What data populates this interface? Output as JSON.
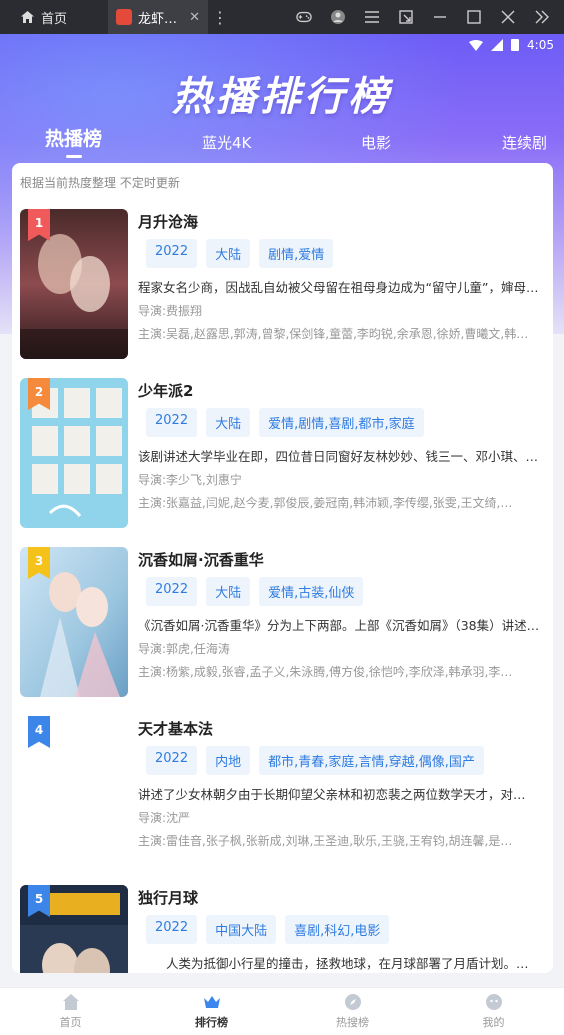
{
  "emulator": {
    "home_label": "首页",
    "tab_label": "龙虾…",
    "tab_close": "✕",
    "more": "⋮",
    "tool_icons": [
      "gamepad-icon",
      "user-circle-icon",
      "menu-icon",
      "popout-icon",
      "minimize-icon",
      "maximize-icon",
      "close-icon",
      "collapse-icon"
    ]
  },
  "status_bar": {
    "time": "4:05"
  },
  "hero": {
    "title": "热播排行榜"
  },
  "tabs": [
    {
      "label": "热播榜",
      "active": true
    },
    {
      "label": "蓝光4K",
      "active": false
    },
    {
      "label": "电影",
      "active": false
    },
    {
      "label": "连续剧",
      "active": false
    }
  ],
  "list": {
    "subtitle": "根据当前热度整理 不定时更新",
    "items": [
      {
        "rank": "1",
        "rank_color": "#f05a5a",
        "title": "月升沧海",
        "tags": [
          "2022",
          "大陆",
          "剧情,爱情"
        ],
        "desc": "程家女名少商，因战乱自幼被父母留在祖母身边成为“留守儿童”，婶母苛刻…",
        "director": "导演:费振翔",
        "cast": "主演:吴磊,赵露思,郭涛,曾黎,保剑锋,童蕾,李昀锐,余承恩,徐娇,曹曦文,韩…"
      },
      {
        "rank": "2",
        "rank_color": "#f58a3c",
        "title": "少年派2",
        "tags": [
          "2022",
          "大陆",
          "爱情,剧情,喜剧,都市,家庭"
        ],
        "desc": "该剧讲述大学毕业在即，四位昔日同窗好友林妙妙、钱三一、邓小琪、江天昊…",
        "director": "导演:李少飞,刘惠宁",
        "cast": "主演:张嘉益,闫妮,赵今麦,郭俊辰,姜冠南,韩沛颖,李传缨,张雯,王文绮,…"
      },
      {
        "rank": "3",
        "rank_color": "#f5c21b",
        "title": "沉香如屑·沉香重华",
        "tags": [
          "2022",
          "大陆",
          "爱情,古装,仙侠"
        ],
        "desc": "《沉香如屑·沉香重华》分为上下两部。上部《沉香如屑》（38集）讲述…",
        "director": "导演:郭虎,任海涛",
        "cast": "主演:杨紫,成毅,张睿,孟子义,朱泳腾,傅方俊,徐恺吟,李欣泽,韩承羽,李…"
      },
      {
        "rank": "4",
        "rank_color": "#3b86e8",
        "title": "天才基本法",
        "tags": [
          "2022",
          "内地",
          "都市,青春,家庭,言情,穿越,偶像,国产"
        ],
        "desc": "讲述了少女林朝夕由于长期仰望父亲林和初恋裴之两位数学天才，对…",
        "director": "导演:沈严",
        "cast": "主演:雷佳音,张子枫,张新成,刘琳,王圣迪,耿乐,王骁,王宥钧,胡连馨,是…"
      },
      {
        "rank": "5",
        "rank_color": "#3b86e8",
        "title": "独行月球",
        "tags": [
          "2022",
          "中国大陆",
          "喜剧,科幻,电影"
        ],
        "desc": "人类为抵御小行星的撞击，拯救地球，在月球部署了月盾计划。…",
        "director": "",
        "cast": ""
      }
    ]
  },
  "bottom_nav": [
    {
      "label": "首页",
      "icon": "home-icon",
      "active": false
    },
    {
      "label": "排行榜",
      "icon": "crown-icon",
      "active": true
    },
    {
      "label": "热搜榜",
      "icon": "compass-icon",
      "active": false
    },
    {
      "label": "我的",
      "icon": "profile-icon",
      "active": false
    }
  ]
}
